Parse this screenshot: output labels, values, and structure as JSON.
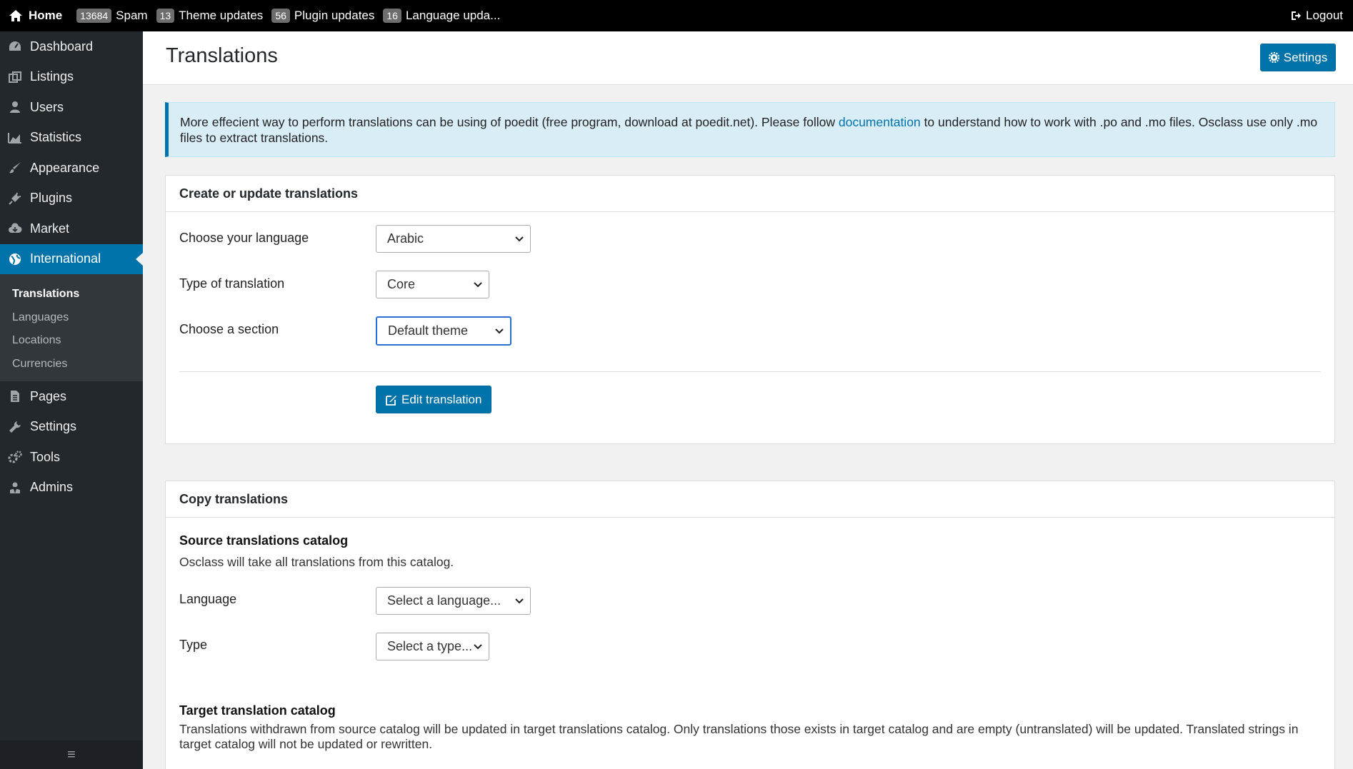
{
  "topbar": {
    "home_label": "Home",
    "items": [
      {
        "count": "13684",
        "label": "Spam"
      },
      {
        "count": "13",
        "label": "Theme updates"
      },
      {
        "count": "56",
        "label": "Plugin updates"
      },
      {
        "count": "16",
        "label": "Language upda..."
      }
    ],
    "logout_label": "Logout"
  },
  "sidebar": {
    "items": [
      {
        "label": "Dashboard",
        "icon": "dashboard-icon"
      },
      {
        "label": "Listings",
        "icon": "listings-icon"
      },
      {
        "label": "Users",
        "icon": "user-icon"
      },
      {
        "label": "Statistics",
        "icon": "chart-icon"
      },
      {
        "label": "Appearance",
        "icon": "brush-icon"
      },
      {
        "label": "Plugins",
        "icon": "plug-icon"
      },
      {
        "label": "Market",
        "icon": "cloud-icon"
      },
      {
        "label": "International",
        "icon": "globe-icon",
        "active": true
      }
    ],
    "submenu": [
      "Translations",
      "Languages",
      "Locations",
      "Currencies"
    ],
    "items_after": [
      {
        "label": "Pages",
        "icon": "page-icon"
      },
      {
        "label": "Settings",
        "icon": "wrench-icon"
      },
      {
        "label": "Tools",
        "icon": "cogs-icon"
      },
      {
        "label": "Admins",
        "icon": "admin-icon"
      }
    ]
  },
  "header": {
    "title": "Translations",
    "settings_label": "Settings"
  },
  "info": {
    "text_before": "More effecient way to perform translations can be using of poedit (free program, download at poedit.net). Please follow ",
    "link": "documentation",
    "text_after": " to understand how to work with .po and .mo files. Osclass use only .mo files to extract translations."
  },
  "create_panel": {
    "title": "Create or update translations",
    "language_label": "Choose your language",
    "language_value": "Arabic",
    "type_label": "Type of translation",
    "type_value": "Core",
    "section_label": "Choose a section",
    "section_value": "Default theme",
    "edit_label": "Edit translation"
  },
  "copy_panel": {
    "title": "Copy translations",
    "source_title": "Source translations catalog",
    "source_desc": "Osclass will take all translations from this catalog.",
    "language_label": "Language",
    "language_placeholder": "Select a language...",
    "type_label": "Type",
    "type_placeholder": "Select a type...",
    "target_title": "Target translation catalog",
    "target_desc": "Translations withdrawn from source catalog will be updated in target translations catalog. Only translations those exists in target catalog and are empty (untranslated) will be updated. Translated strings in target catalog will not be updated or rewritten."
  },
  "colors": {
    "accent": "#0073aa",
    "sidebar_bg": "#23282d",
    "info_bg": "#d9edf7"
  }
}
